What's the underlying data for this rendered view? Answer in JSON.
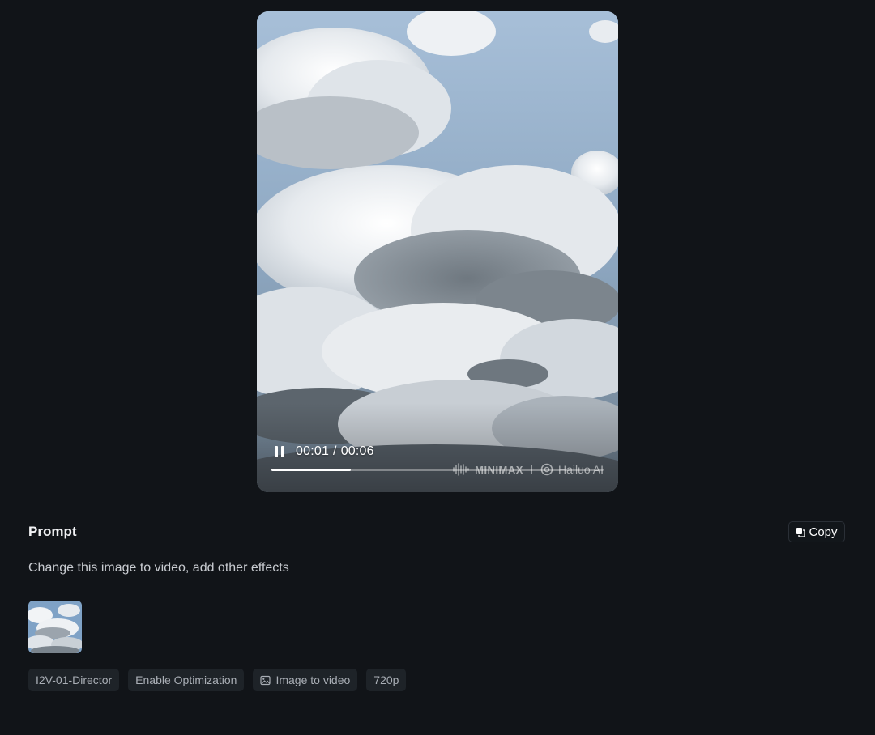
{
  "player": {
    "state": "playing",
    "current_time": "00:01",
    "separator": "/",
    "duration": "00:06",
    "progress_fraction": 0.24,
    "watermark_brand": "MINIMAX",
    "watermark_product": "Hailuo AI",
    "toggle_icon": "pause-icon"
  },
  "prompt": {
    "heading": "Prompt",
    "copy_label": "Copy",
    "copy_icon": "copy-icon",
    "text": "Change this image to video, add other effects",
    "reference_image_icon": "cloud-thumbnail"
  },
  "tags": [
    {
      "label": "I2V-01-Director",
      "icon": ""
    },
    {
      "label": "Enable Optimization",
      "icon": ""
    },
    {
      "label": "Image to video",
      "icon": "image-icon"
    },
    {
      "label": "720p",
      "icon": ""
    }
  ],
  "colors": {
    "background": "#111418",
    "tag_background": "#1e2328",
    "text_primary": "#f2f3f5",
    "text_secondary": "#a9aeb5"
  }
}
